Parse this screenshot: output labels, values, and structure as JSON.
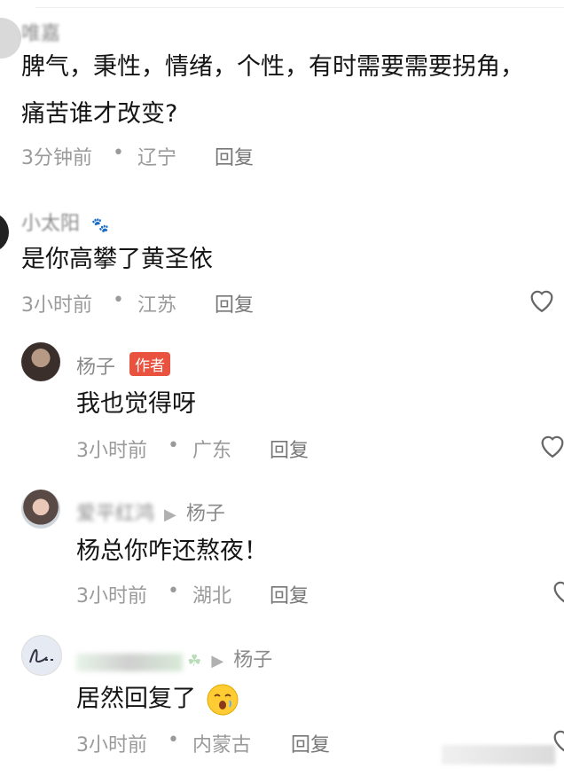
{
  "comments": [
    {
      "username": "唯嘉",
      "text_line1": "脾气，秉性，情绪，个性，有时需要需要拐角，",
      "text_line2": "痛苦谁才改变?",
      "time": "3分钟前",
      "location": "辽宁",
      "reply": "回复"
    },
    {
      "username": "小太阳",
      "text": "是你高攀了黄圣依",
      "time": "3小时前",
      "location": "江苏",
      "reply": "回复"
    },
    {
      "username": "杨子",
      "badge": "作者",
      "text": "我也觉得呀",
      "time": "3小时前",
      "location": "广东",
      "reply": "回复"
    },
    {
      "username": "爱平红鸿",
      "reply_to": "杨子",
      "text": "杨总你咋还熬夜！",
      "time": "3小时前",
      "location": "湖北",
      "reply": "回复"
    },
    {
      "reply_to": "杨子",
      "text": "居然回复了",
      "time": "3小时前",
      "location": "内蒙古",
      "reply": "回复"
    }
  ],
  "separator": "•",
  "arrow": "▶",
  "icons": {
    "like": "heart-outline-icon",
    "emoji": "sleepy-face-emoji"
  },
  "colors": {
    "badge": "#e8523f",
    "meta": "#9a9a9a",
    "text": "#141414"
  }
}
